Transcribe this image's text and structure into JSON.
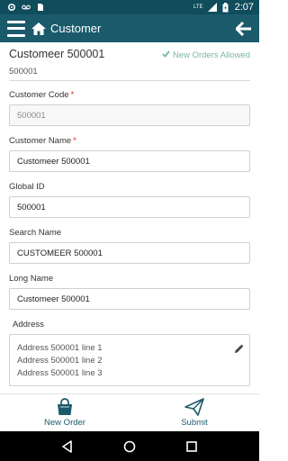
{
  "status_bar": {
    "time": "2:07",
    "network": "LTE",
    "icons": [
      "settings-icon",
      "voicemail-icon",
      "sim-icon",
      "signal-icon",
      "battery-icon"
    ]
  },
  "app_bar": {
    "title": "Customer",
    "icons": [
      "menu-icon",
      "home-icon",
      "back-arrow-icon"
    ]
  },
  "customer": {
    "title": "Customeer 500001",
    "orders_status": "New Orders Allowed",
    "id": "500001"
  },
  "fields": {
    "customer_code": {
      "label": "Customer Code",
      "value": "500001",
      "required": "*"
    },
    "customer_name": {
      "label": "Customer Name",
      "value": "Customeer 500001",
      "required": "*"
    },
    "global_id": {
      "label": "Global ID",
      "value": "500001"
    },
    "search_name": {
      "label": "Search Name",
      "value": "CUSTOMEER 500001"
    },
    "long_name": {
      "label": "Long Name",
      "value": "Customeer 500001"
    }
  },
  "address": {
    "label": "Address",
    "lines": [
      "Address 500001 line 1",
      "Address 500001 line 2",
      "Address 500001 line 3"
    ]
  },
  "bottom_bar": {
    "new_order": "New Order",
    "submit": "Submit"
  },
  "colors": {
    "app_bar": "#1a5a6b",
    "status_bar": "#0f4c5c",
    "accent_green": "#76b9a0",
    "required_red": "#e02020"
  }
}
